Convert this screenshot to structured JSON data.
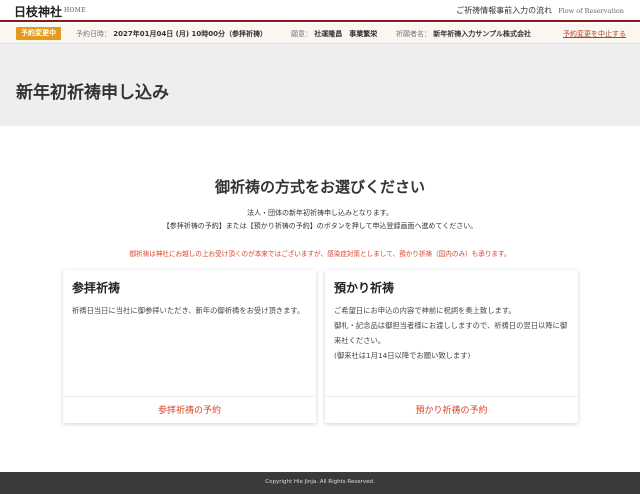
{
  "header": {
    "logo": "日枝神社",
    "home": "HOME",
    "flow_label": "ご祈祷情報事前入力の流れ",
    "flow_en": "Flow of Reservation",
    "border_color": "#8b1a1a"
  },
  "infobar": {
    "badge": "予約変更中",
    "datetime_label": "予約日時：",
    "datetime_value": "2027年01月04日 (月) 10時00分（参拝祈祷）",
    "wish_label": "願意：",
    "wish_value": "社運隆昌　事業繁栄",
    "applicant_label": "祈願者名：",
    "applicant_value": "新年祈祷入力サンプル株式会社",
    "cancel_link": "予約変更を中止する",
    "badge_color": "#e39a1d"
  },
  "page": {
    "title": "新年初祈祷申し込み"
  },
  "main": {
    "section_title": "御祈祷の方式をお選びください",
    "desc_1": "法人・団体の新年初祈祷申し込みとなります。",
    "desc_2": "【参拝祈祷の予約】または【預かり祈祷の予約】のボタンを押して申込登録画面へ進めてください。",
    "notice": "御祈祷は神社にお越しの上お受け頂くのが本来ではございますが、感染症対策としまして、預かり祈祷（国内のみ）も承ります。",
    "accent_color": "#d9432b"
  },
  "cards": {
    "sanpai": {
      "title": "参拝祈祷",
      "body_1": "祈祷日当日に当社に御参拝いただき、新年の御祈祷をお受け頂きます。",
      "link": "参拝祈祷の予約"
    },
    "azukari": {
      "title": "預かり祈祷",
      "body_1": "ご希望日にお申込の内容で神前に祝詞を奏上致します。",
      "body_2": "御札・記念品は御担当者様にお渡ししますので、祈祷日の翌日以降に御来社ください。",
      "body_3": "(御来社は1月14日以降でお願い致します)",
      "link": "預かり祈祷の予約"
    }
  },
  "footer": {
    "copyright": "Copyright Hie Jinja. All Rights Reserved."
  }
}
